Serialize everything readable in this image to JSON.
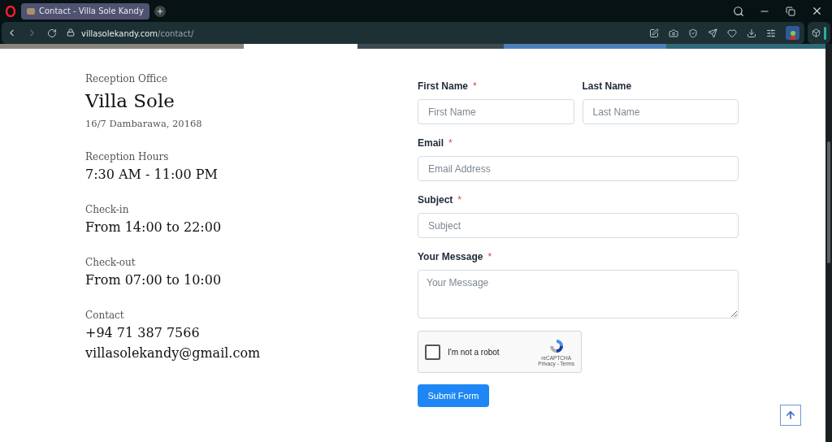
{
  "browser": {
    "tab_title": "Contact - Villa Sole Kandy",
    "url_domain": "villasolekandy.com",
    "url_path": "/contact/"
  },
  "info": [
    {
      "kind": "title",
      "label": "Reception Office",
      "lines": [
        "Villa Sole"
      ],
      "sub": "16/7 Dambarawa, 20168"
    },
    {
      "kind": "plain",
      "label": "Reception Hours",
      "lines": [
        "7:30 AM - 11:00 PM"
      ]
    },
    {
      "kind": "plain",
      "label": "Check-in",
      "lines": [
        "From 14:00 to 22:00"
      ]
    },
    {
      "kind": "plain",
      "label": "Check-out",
      "lines": [
        "From 07:00 to 10:00"
      ]
    },
    {
      "kind": "plain",
      "label": "Contact",
      "lines": [
        "+94 71 387 7566",
        "villasolekandy@gmail.com"
      ]
    }
  ],
  "form": {
    "required_mark": "*",
    "rows": [
      [
        {
          "kind": "input",
          "label": "First Name",
          "required": true,
          "placeholder": "First Name"
        },
        {
          "kind": "input",
          "label": "Last Name",
          "required": false,
          "placeholder": "Last Name"
        }
      ],
      [
        {
          "kind": "input",
          "label": "Email",
          "required": true,
          "placeholder": "Email Address"
        }
      ],
      [
        {
          "kind": "input",
          "label": "Subject",
          "required": true,
          "placeholder": "Subject"
        }
      ],
      [
        {
          "kind": "textarea",
          "label": "Your Message",
          "required": true,
          "placeholder": "Your Message"
        }
      ]
    ],
    "captcha": {
      "label": "I'm not a robot",
      "checked": false,
      "brand": "reCAPTCHA",
      "links": "Privacy - Terms"
    },
    "submit": "Submit Form"
  }
}
